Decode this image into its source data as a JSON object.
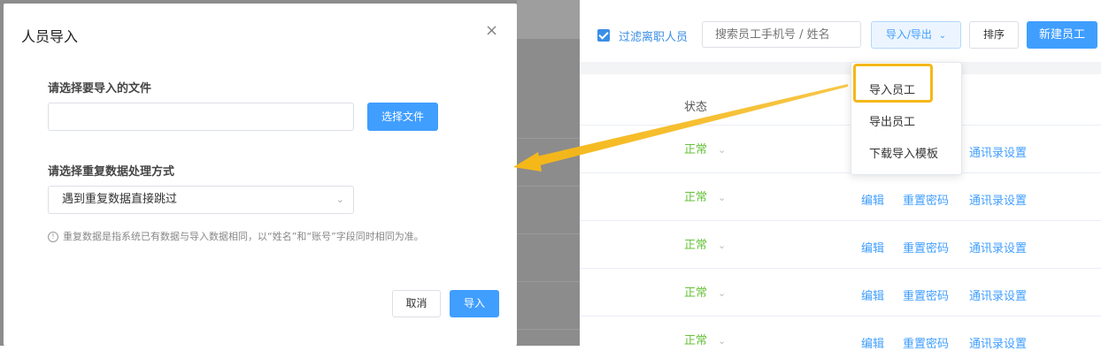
{
  "dialog": {
    "title": "人员导入",
    "close_glyph": "×",
    "file_label": "请选择要导入的文件",
    "file_button": "选择文件",
    "duplicate_label": "请选择重复数据处理方式",
    "duplicate_selected": "遇到重复数据直接跳过",
    "hint": "重复数据是指系统已有数据与导入数据相同，以“姓名”和“账号”字段同时相同为准。",
    "cancel": "取消",
    "import": "导入"
  },
  "toolbar": {
    "filter_label": "过滤离职人员",
    "search_placeholder": "搜索员工手机号 / 姓名",
    "import_export": "导入/导出",
    "sort": "排序",
    "new_employee": "新建员工"
  },
  "table": {
    "status_header": "状态",
    "rows": [
      {
        "status": "正常",
        "edit": "",
        "reset": "",
        "contacts": "通讯录设置"
      },
      {
        "status": "正常",
        "edit": "编辑",
        "reset": "重置密码",
        "contacts": "通讯录设置"
      },
      {
        "status": "正常",
        "edit": "编辑",
        "reset": "重置密码",
        "contacts": "通讯录设置"
      },
      {
        "status": "正常",
        "edit": "编辑",
        "reset": "重置密码",
        "contacts": "通讯录设置"
      },
      {
        "status": "正常",
        "edit": "编辑",
        "reset": "重置密码",
        "contacts": "通讯录设置"
      }
    ]
  },
  "dropdown": {
    "items": [
      "导入员工",
      "导出员工",
      "下载导入模板"
    ]
  },
  "colors": {
    "primary": "#409eff",
    "success": "#67c23a",
    "highlight": "#f5b819",
    "overlay": "#8c8c8c"
  },
  "icons": {
    "checkbox": "checkbox-checked-icon",
    "chevron": "chevron-down-icon",
    "info": "info-circle-icon",
    "close": "close-icon",
    "arrow": "annotation-arrow"
  }
}
